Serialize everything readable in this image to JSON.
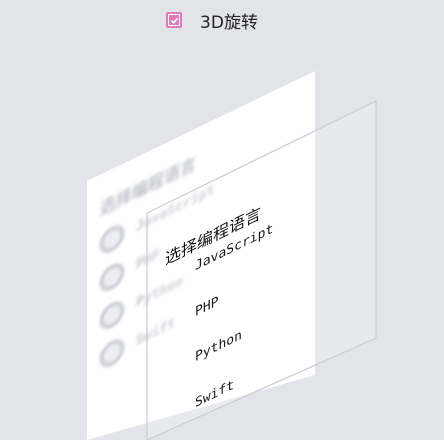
{
  "toggle": {
    "label": "3D旋转",
    "checked": true,
    "accent_color": "#e07ab3"
  },
  "back_panel": {
    "title": "选择编程语言",
    "options": [
      "JavaScript",
      "PHP",
      "Python",
      "Swift"
    ]
  },
  "front_panel": {
    "title": "选择编程语言",
    "options": [
      "JavaScript",
      "PHP",
      "Python",
      "Swift"
    ]
  }
}
